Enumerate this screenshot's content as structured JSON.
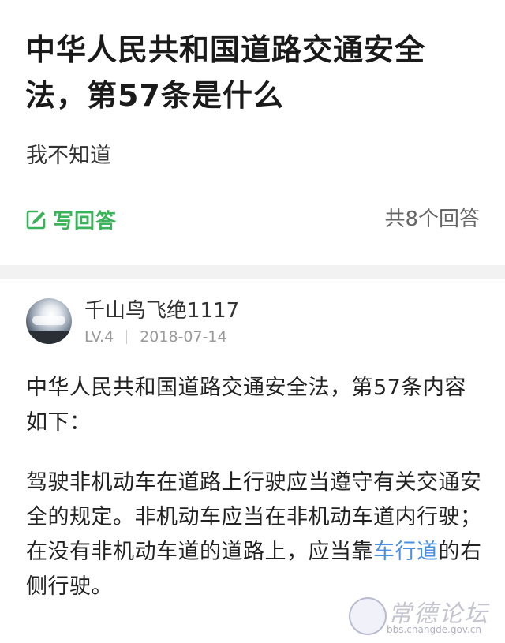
{
  "question": {
    "title": "中华人民共和国道路交通安全法，第57条是什么",
    "description": "我不知道",
    "write_answer_label": "写回答",
    "answer_count": "共8个回答"
  },
  "answer": {
    "username": "千山鸟飞绝1117",
    "level": "LV.4",
    "date": "2018-07-14",
    "paragraph1": "中华人民共和国道路交通安全法，第57条内容如下：",
    "paragraph2_before_link": "驾驶非机动车在道路上行驶应当遵守有关交通安全的规定。非机动车应当在非机动车道内行驶；在没有非机动车道的道路上，应当靠",
    "paragraph2_link": "车行道",
    "paragraph2_after_link": "的右侧行驶。"
  },
  "watermark": {
    "logo_text": "常德论坛",
    "url": "bbs.changde.gov.cn"
  },
  "colors": {
    "accent_green": "#3bb35a",
    "link_blue": "#4a90e2",
    "divider_gray": "#f2f2f2"
  },
  "icons": {
    "write": "edit-icon"
  }
}
